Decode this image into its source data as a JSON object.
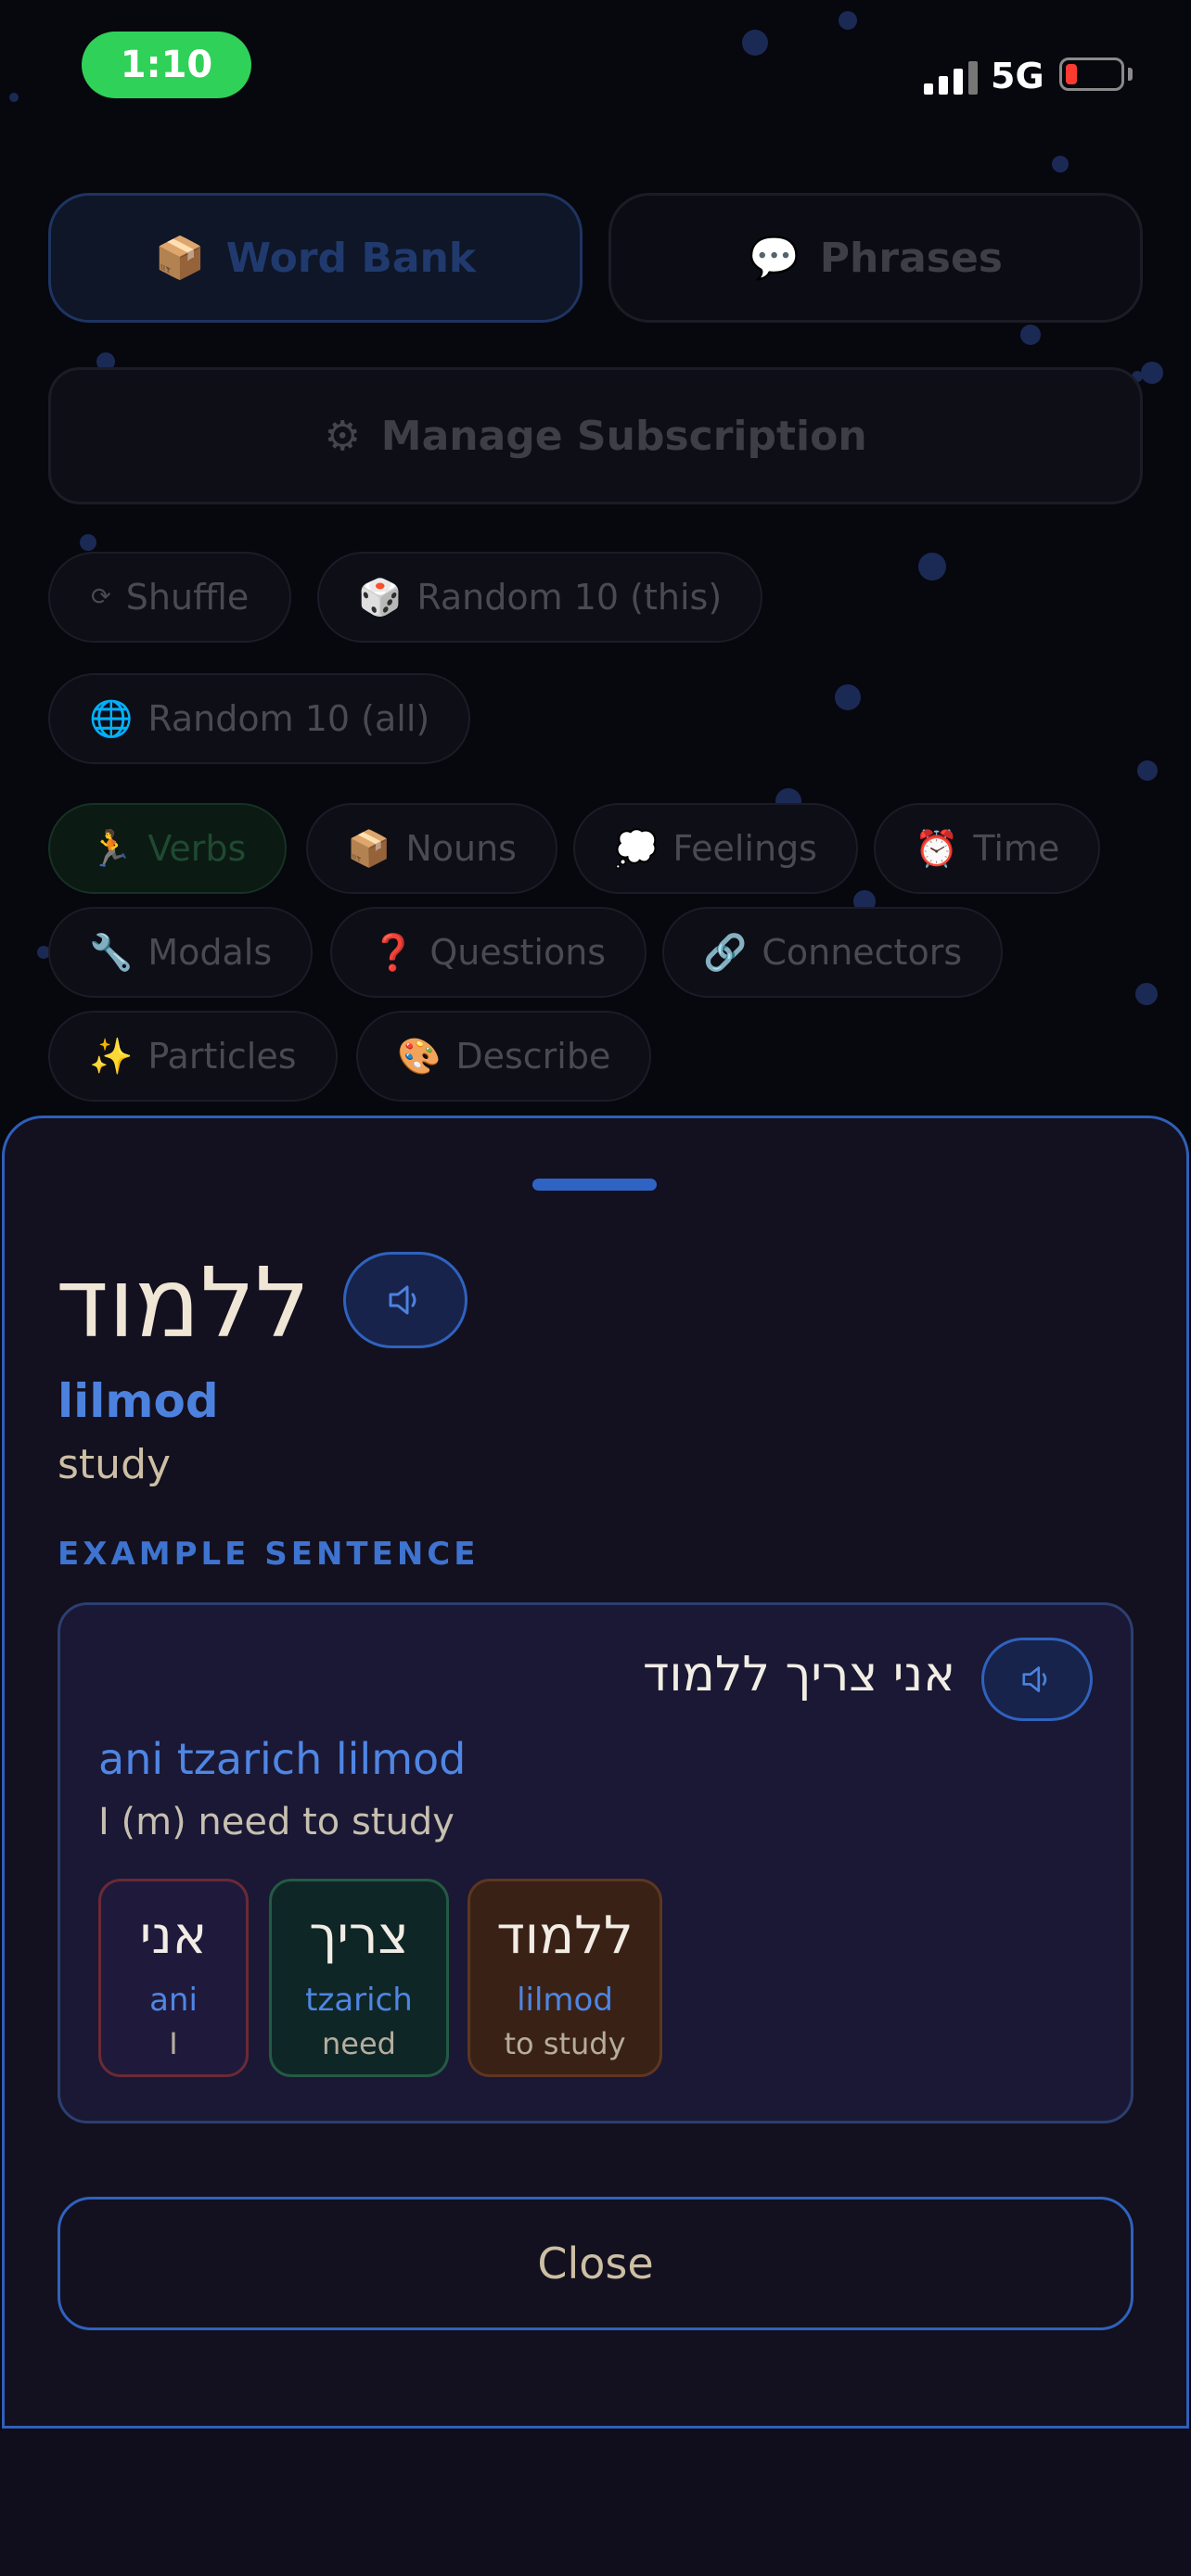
{
  "status_bar": {
    "time": "1:10",
    "network": "5G"
  },
  "background": {
    "word_bank_label": "Word Bank",
    "phrases_label": "Phrases",
    "manage_label": "Manage Subscription",
    "shuffle_label": "Shuffle",
    "random_this_label": "Random 10 (this)",
    "random_all_label": "Random 10 (all)",
    "categories": {
      "verbs": "Verbs",
      "nouns": "Nouns",
      "feelings": "Feelings",
      "time": "Time",
      "modals": "Modals",
      "questions": "Questions",
      "connectors": "Connectors",
      "particles": "Particles",
      "describe": "Describe"
    }
  },
  "sheet": {
    "word": "ללמוד",
    "transliteration": "lilmod",
    "meaning": "study",
    "example_label": "EXAMPLE SENTENCE",
    "example": {
      "hebrew": "אני צריך ללמוד",
      "transliteration": "ani tzarich lilmod",
      "meaning": "I (m) need to study",
      "words": [
        {
          "hebrew": "אני",
          "translit": "ani",
          "gloss": "I"
        },
        {
          "hebrew": "צריך",
          "translit": "tzarich",
          "gloss": "need"
        },
        {
          "hebrew": "ללמוד",
          "translit": "lilmod",
          "gloss": "to study"
        }
      ]
    },
    "close_label": "Close"
  },
  "colors": {
    "accent": "#2f62be",
    "chip_pronoun": "#8a2f3a",
    "chip_verb": "#2a6a4a",
    "chip_infinitive": "#6a3a1a"
  }
}
